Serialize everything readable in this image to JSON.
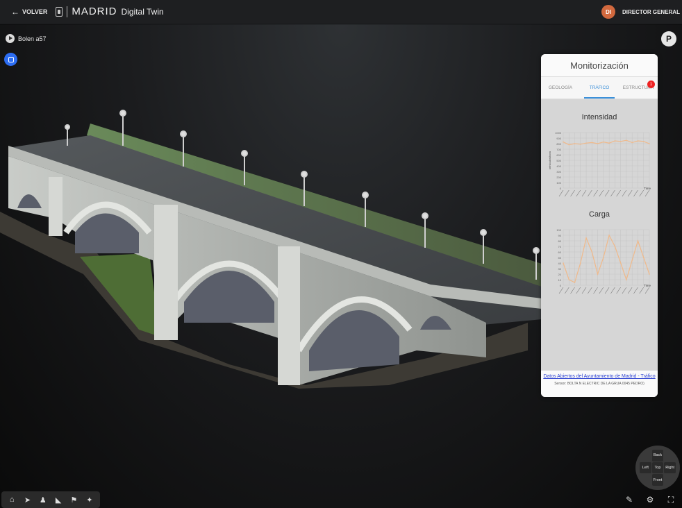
{
  "topbar": {
    "back_label": "VOLVER",
    "brand_name": "MADRID",
    "brand_sub": "Digital Twin",
    "avatar_initials": "DI",
    "user_name": "DIRECTOR GENERAL"
  },
  "viewer": {
    "model_label": "Bolen a57"
  },
  "panel": {
    "title": "Monitorización",
    "tabs": [
      "GEOLOGÍA",
      "TRÁFICO",
      "ESTRUCTURA"
    ],
    "active_tab": "TRÁFICO",
    "badge": "1",
    "chart1_title": "Intensidad",
    "chart2_title": "Carga",
    "y_axis_label": "vehículos/hora",
    "x_axis_label": "Time",
    "footer_link": "Datos Abiertos del Ayuntamiento de Madrid - Tráfico",
    "footer_note": "Sensor: BOLTA N ELECTRIC DE LA GRUA 0045 PEDRO)",
    "accent_color": "#3a8fd9",
    "line_color": "#f0b98a"
  },
  "chart_data": [
    {
      "type": "line",
      "title": "Intensidad",
      "ylabel": "vehículos/hora",
      "xlabel": "Time",
      "ylim": [
        0,
        1000
      ],
      "y_ticks": [
        "1000",
        "900",
        "800",
        "700",
        "600",
        "500",
        "400",
        "300",
        "200",
        "100",
        "0"
      ],
      "values": [
        830,
        780,
        800,
        790,
        810,
        820,
        800,
        830,
        810,
        850,
        840,
        860,
        820,
        850,
        840,
        800
      ]
    },
    {
      "type": "line",
      "title": "Carga",
      "xlabel": "Time",
      "ylim": [
        0,
        100
      ],
      "y_ticks": [
        "100",
        "90",
        "80",
        "70",
        "60",
        "50",
        "40",
        "30",
        "20",
        "10",
        "0"
      ],
      "values": [
        40,
        10,
        5,
        40,
        85,
        60,
        20,
        50,
        90,
        70,
        40,
        10,
        45,
        80,
        50,
        20
      ]
    }
  ],
  "toolbar": {
    "icons": [
      "home-icon",
      "fly-icon",
      "person-icon",
      "measure-icon",
      "walk-icon",
      "run-icon"
    ]
  },
  "nav_cube": {
    "back": "Back",
    "left": "Left",
    "top": "Top",
    "right": "Right",
    "front": "Front"
  }
}
